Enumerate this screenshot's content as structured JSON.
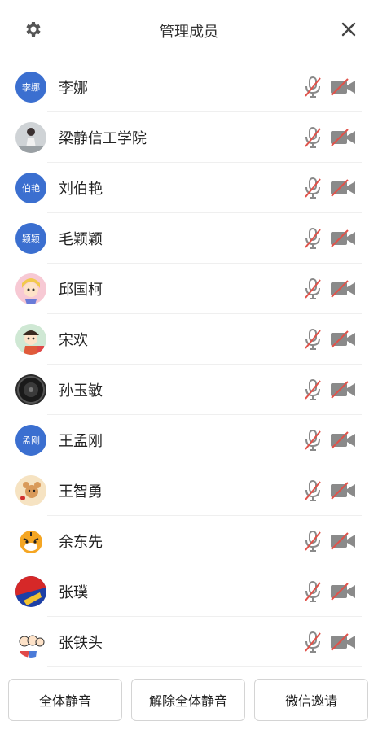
{
  "header": {
    "title": "管理成员",
    "settings_icon": "gear-icon",
    "close_icon": "close-icon"
  },
  "members": [
    {
      "name": "李娜",
      "avatar": {
        "type": "text",
        "text": "李娜"
      }
    },
    {
      "name": "梁静信工学院",
      "avatar": {
        "type": "photo",
        "icon": "person-photo"
      }
    },
    {
      "name": "刘伯艳",
      "avatar": {
        "type": "text",
        "text": "伯艳"
      }
    },
    {
      "name": "毛颖颖",
      "avatar": {
        "type": "text",
        "text": "颖颖"
      }
    },
    {
      "name": "邱国柯",
      "avatar": {
        "type": "photo",
        "icon": "cartoon-girl"
      }
    },
    {
      "name": "宋欢",
      "avatar": {
        "type": "photo",
        "icon": "cartoon-girl-hat"
      }
    },
    {
      "name": "孙玉敏",
      "avatar": {
        "type": "photo",
        "icon": "dark-circle"
      }
    },
    {
      "name": "王孟刚",
      "avatar": {
        "type": "text",
        "text": "孟刚"
      }
    },
    {
      "name": "王智勇",
      "avatar": {
        "type": "photo",
        "icon": "cartoon-mouse"
      }
    },
    {
      "name": "余东先",
      "avatar": {
        "type": "photo",
        "icon": "tiger"
      }
    },
    {
      "name": "张璞",
      "avatar": {
        "type": "photo",
        "icon": "colorful-circle"
      }
    },
    {
      "name": "张铁头",
      "avatar": {
        "type": "photo",
        "icon": "cartoon-people"
      }
    }
  ],
  "buttons": {
    "mute_all": "全体静音",
    "unmute_all": "解除全体静音",
    "wechat_invite": "微信邀请"
  },
  "colors": {
    "avatar_blue": "#3b6fd0",
    "muted_red": "#e0524a",
    "icon_gray": "#8a8a8a"
  }
}
